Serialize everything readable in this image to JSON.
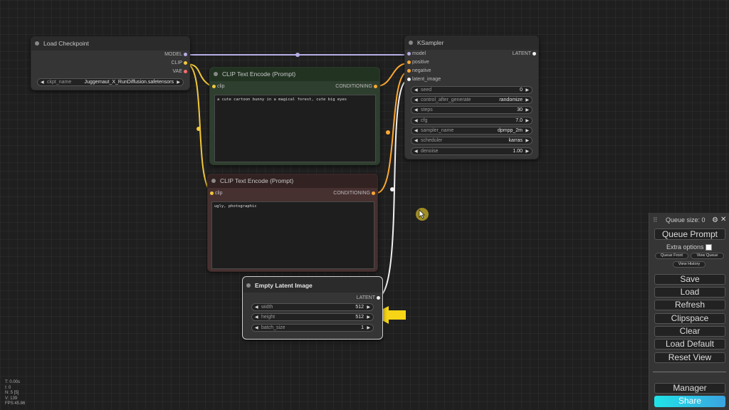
{
  "colors": {
    "clip": "#f2c73b",
    "model": "#b7aee7",
    "vae": "#ff6e6e",
    "conditioning": "#ffa931",
    "latent": "#f0f0f0",
    "positive_node_bg": "#2f3f2f",
    "negative_node_bg": "#473030",
    "arrow": "#f5d516",
    "share_gradient": "#20e3e8"
  },
  "load_checkpoint": {
    "title": "Load Checkpoint",
    "outputs": [
      "MODEL",
      "CLIP",
      "VAE"
    ],
    "ckpt_label": "ckpt_name",
    "ckpt_value": "Juggernaut_X_RunDiffusion.safetensors"
  },
  "clip_positive": {
    "title": "CLIP Text Encode (Prompt)",
    "input": "clip",
    "output": "CONDITIONING",
    "text": "a cute cartoon bunny in a magical forest, cute big eyes"
  },
  "clip_negative": {
    "title": "CLIP Text Encode (Prompt)",
    "input": "clip",
    "output": "CONDITIONING",
    "text": "ugly, photographic"
  },
  "ksampler": {
    "title": "KSampler",
    "inputs": [
      "model",
      "positive",
      "negative",
      "latent_image"
    ],
    "output": "LATENT",
    "widgets": [
      {
        "name": "seed",
        "value": "0"
      },
      {
        "name": "control_after_generate",
        "value": "randomize"
      },
      {
        "name": "steps",
        "value": "30"
      },
      {
        "name": "cfg",
        "value": "7.0"
      },
      {
        "name": "sampler_name",
        "value": "dpmpp_2m"
      },
      {
        "name": "scheduler",
        "value": "karras"
      },
      {
        "name": "denoise",
        "value": "1.00"
      }
    ]
  },
  "empty_latent": {
    "title": "Empty Latent Image",
    "output": "LATENT",
    "widgets": [
      {
        "name": "width",
        "value": "512"
      },
      {
        "name": "height",
        "value": "512"
      },
      {
        "name": "batch_size",
        "value": "1"
      }
    ]
  },
  "menu": {
    "queue_size": "Queue size: 0",
    "queue_prompt": "Queue Prompt",
    "extra_options": "Extra options",
    "queue_front": "Queue Front",
    "view_queue": "View Queue",
    "view_history": "View History",
    "save": "Save",
    "load": "Load",
    "refresh": "Refresh",
    "clipspace": "Clipspace",
    "clear": "Clear",
    "load_default": "Load Default",
    "reset_view": "Reset View",
    "manager": "Manager",
    "share": "Share"
  },
  "stats": {
    "t": "T: 0.00s",
    "i": "I: 0",
    "n": "N: 5 [5]",
    "v": "V: 139",
    "fps": "FPS:45.86"
  }
}
